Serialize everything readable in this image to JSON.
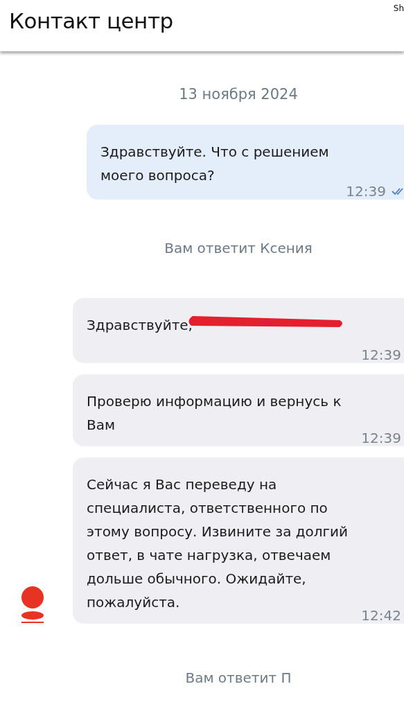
{
  "header": {
    "title": "Контакт центр",
    "corner_label": "Sh"
  },
  "messages": [
    {
      "kind": "date",
      "text": "13 ноября 2024"
    },
    {
      "kind": "outgoing",
      "text": "Здравствуйте. Что с решением моего вопроса?",
      "time": "12:39",
      "read": true
    },
    {
      "kind": "notice",
      "text": "Вам ответит Ксения"
    },
    {
      "kind": "incoming",
      "text": "Здравствуйте,",
      "redacted": true,
      "time": "12:39",
      "avatar": false
    },
    {
      "kind": "incoming",
      "text": "Проверю информацию и вернусь к Вам",
      "redacted": false,
      "time": "12:39",
      "avatar": false
    },
    {
      "kind": "incoming",
      "text": "Сейчас я Вас переведу на специалиста, ответственного по этому вопросу. Извините за долгий ответ, в чате нагрузка, отвечаем дольше обычного. Ожидайте, пожалуйста.",
      "redacted": false,
      "time": "12:42",
      "avatar": true
    },
    {
      "kind": "notice",
      "text": "Вам ответит П"
    }
  ]
}
